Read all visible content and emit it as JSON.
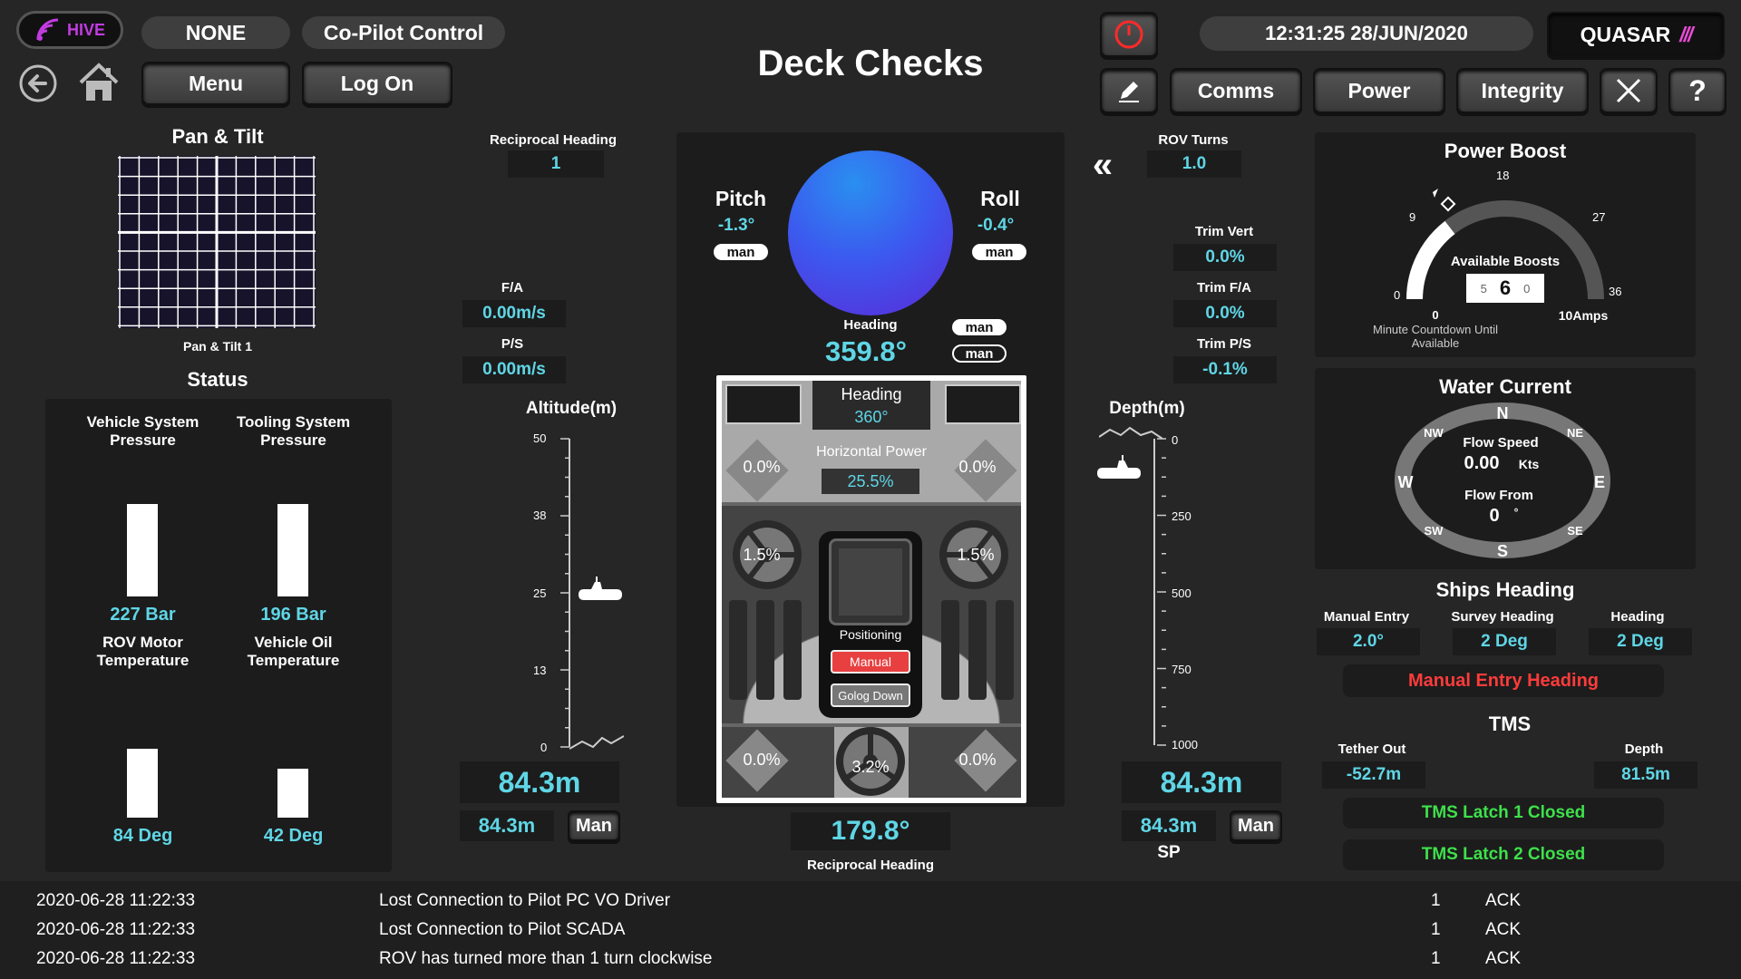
{
  "header": {
    "logo_text": "HIVE",
    "mode": "NONE",
    "control": "Co-Pilot Control",
    "menu": "Menu",
    "logon": "Log On",
    "title": "Deck Checks",
    "datetime": "12:31:25  28/JUN/2020",
    "brand": "QUASAR",
    "comms": "Comms",
    "power": "Power",
    "integrity": "Integrity"
  },
  "pan_tilt": {
    "title": "Pan & Tilt",
    "caption": "Pan & Tilt 1"
  },
  "status": {
    "title": "Status",
    "col1_title": "Vehicle System Pressure",
    "col2_title": "Tooling System Pressure",
    "col1_value": "227 Bar",
    "col2_value": "196 Bar",
    "col1_fill": 0.85,
    "col2_fill": 0.85,
    "col3_title": "ROV Motor Temperature",
    "col4_title": "Vehicle Oil Temperature",
    "col3_value": "84 Deg",
    "col4_value": "42 Deg",
    "col3_fill": 0.84,
    "col4_fill": 0.6
  },
  "left_nav": {
    "reciprocal_heading_label": "Reciprocal Heading",
    "reciprocal_heading_value": "1",
    "fa_label": "F/A",
    "fa_value": "0.00m/s",
    "ps_label": "P/S",
    "ps_value": "0.00m/s",
    "altitude_label": "Altitude(m)",
    "altitude_ticks": [
      "50",
      "38",
      "25",
      "13",
      "0"
    ],
    "altitude_value": "84.3m",
    "altitude_sp": "84.3m",
    "altitude_man": "Man"
  },
  "center": {
    "pitch_label": "Pitch",
    "pitch_value": "-1.3°",
    "pitch_chip": "man",
    "roll_label": "Roll",
    "roll_value": "-0.4°",
    "roll_chip": "man",
    "heading_label": "Heading",
    "heading_value": "359.8°",
    "heading_chip1": "man",
    "heading_chip2": "man",
    "thr_heading_label": "Heading",
    "thr_heading_value": "360°",
    "hpower_label": "Horizontal Power",
    "hpower_value": "25.5%",
    "thr_tl": "0.0%",
    "thr_tr": "0.0%",
    "thr_ml": "1.5%",
    "thr_mr": "1.5%",
    "thr_bl": "0.0%",
    "thr_bc": "3.2%",
    "thr_br": "0.0%",
    "positioning_label": "Positioning",
    "manual_btn": "Manual",
    "golog_btn": "Golog Down",
    "recip_value": "179.8°",
    "recip_label": "Reciprocal Heading"
  },
  "right_nav": {
    "rov_turns_label": "ROV Turns",
    "rov_turns_value": "1.0",
    "trim_vert_label": "Trim Vert",
    "trim_vert_value": "0.0%",
    "trim_fa_label": "Trim F/A",
    "trim_fa_value": "0.0%",
    "trim_ps_label": "Trim P/S",
    "trim_ps_value": "-0.1%",
    "depth_label": "Depth(m)",
    "depth_ticks": [
      "0",
      "250",
      "500",
      "750",
      "1000"
    ],
    "depth_value": "84.3m",
    "depth_sp": "84.3m",
    "depth_man": "Man",
    "sp_label": "SP"
  },
  "power_boost": {
    "title": "Power Boost",
    "gauge_labels": [
      "0",
      "9",
      "18",
      "27",
      "36"
    ],
    "available_label": "Available Boosts",
    "avail_left": "5",
    "avail_value": "6",
    "avail_right": "0",
    "countdown_value": "0",
    "countdown_label": "Minute Countdown Until Available",
    "amps_label": "10Amps"
  },
  "water_current": {
    "title": "Water Current",
    "compass": [
      "N",
      "NE",
      "E",
      "SE",
      "S",
      "SW",
      "W",
      "NW"
    ],
    "flow_speed_label": "Flow Speed",
    "flow_speed_value": "0.00",
    "flow_speed_unit": "Kts",
    "flow_from_label": "Flow From",
    "flow_from_value": "0",
    "flow_from_unit": "°"
  },
  "ships_heading": {
    "title": "Ships Heading",
    "manual_label": "Manual Entry",
    "manual_value": "2.0°",
    "survey_label": "Survey Heading",
    "survey_value": "2 Deg",
    "heading_label": "Heading",
    "heading_value": "2 Deg",
    "manual_btn": "Manual Entry Heading"
  },
  "tms": {
    "title": "TMS",
    "tether_label": "Tether Out",
    "tether_value": "-52.7m",
    "depth_label": "Depth",
    "depth_value": "81.5m",
    "latch1": "TMS Latch 1 Closed",
    "latch2": "TMS Latch 2 Closed"
  },
  "alarms": [
    {
      "time": "2020-06-28  11:22:33",
      "msg": "Lost Connection to Pilot PC VO Driver",
      "count": "1",
      "ack": "ACK"
    },
    {
      "time": "2020-06-28  11:22:33",
      "msg": "Lost Connection to Pilot SCADA",
      "count": "1",
      "ack": "ACK"
    },
    {
      "time": "2020-06-28  11:22:33",
      "msg": "ROV has turned more than 1 turn clockwise",
      "count": "1",
      "ack": "ACK"
    }
  ],
  "colors": {
    "accent": "#5fd6e6",
    "alarm_red": "#ff3b3b",
    "ok_green": "#3ee04b",
    "hive_purple": "#c23be0"
  }
}
